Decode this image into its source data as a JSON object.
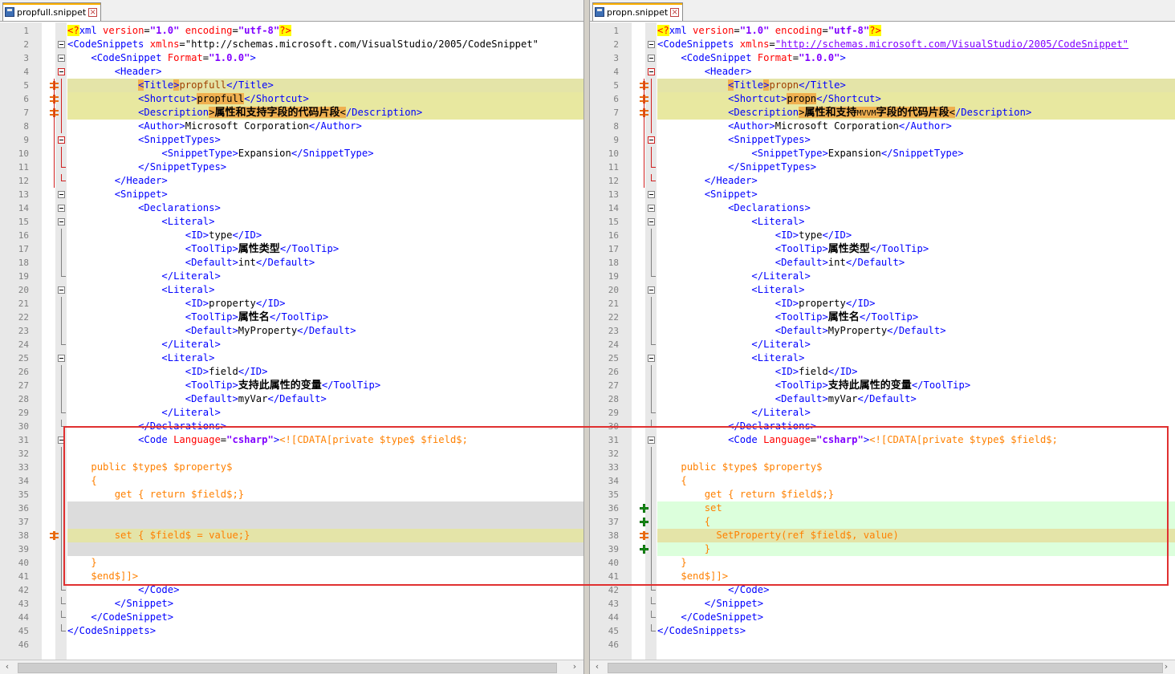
{
  "left": {
    "tab": "propfull.snippet",
    "lines": [
      {
        "n": "1",
        "html": "<span class='c-pi'>&lt;?</span><span class='c-tag'>xml </span><span class='c-attr'>version</span>=<span class='c-val'>\"1.0\"</span> <span class='c-attr'>encoding</span>=<span class='c-val'>\"utf-8\"</span><span class='c-pi'>?&gt;</span>"
      },
      {
        "n": "2",
        "html": "<span class='c-tag'>&lt;CodeSnippets </span><span class='c-attr'>xmlns</span>=\"http://schemas.microsoft.com/VisualStudio/2005/CodeSnippet\""
      },
      {
        "n": "3",
        "html": "    <span class='c-tag'>&lt;CodeSnippet </span><span class='c-attr'>Format</span>=<span class='c-val'>\"1.0.0\"</span><span class='c-tag'>&gt;</span>"
      },
      {
        "n": "4",
        "html": "        <span class='c-tag'>&lt;Header&gt;</span>"
      },
      {
        "n": "5",
        "html": "            <span class='c-tag' style='background:#f0b050'>&lt;</span><span class='c-tag'>Title</span><span class='c-tag' style='background:#f0b050'>&gt;</span><span style='color:#a04000'>propfull</span><span class='c-tag'>&lt;/Title&gt;</span>"
      },
      {
        "n": "6",
        "html": "            <span class='c-tag'>&lt;Shortcut&gt;</span><span class='c-hilite'>propfull</span><span class='c-tag'>&lt;/Shortcut&gt;</span>"
      },
      {
        "n": "7",
        "html": "            <span class='c-tag'>&lt;Description</span><span class='c-hilite'>&gt;<span class='c-cn'>属性和支持字段的代码片段</span>&lt;</span><span class='c-tag'>/Description&gt;</span>"
      },
      {
        "n": "8",
        "html": "            <span class='c-tag'>&lt;Author&gt;</span>Microsoft Corporation<span class='c-tag'>&lt;/Author&gt;</span>"
      },
      {
        "n": "9",
        "html": "            <span class='c-tag'>&lt;SnippetTypes&gt;</span>"
      },
      {
        "n": "10",
        "html": "                <span class='c-tag'>&lt;SnippetType&gt;</span>Expansion<span class='c-tag'>&lt;/SnippetType&gt;</span>"
      },
      {
        "n": "11",
        "html": "            <span class='c-tag'>&lt;/SnippetTypes&gt;</span>"
      },
      {
        "n": "12",
        "html": "        <span class='c-tag'>&lt;/Header&gt;</span>"
      },
      {
        "n": "13",
        "html": "        <span class='c-tag'>&lt;Snippet&gt;</span>"
      },
      {
        "n": "14",
        "html": "            <span class='c-tag'>&lt;Declarations&gt;</span>"
      },
      {
        "n": "15",
        "html": "                <span class='c-tag'>&lt;Literal&gt;</span>"
      },
      {
        "n": "16",
        "html": "                    <span class='c-tag'>&lt;ID&gt;</span>type<span class='c-tag'>&lt;/ID&gt;</span>"
      },
      {
        "n": "17",
        "html": "                    <span class='c-tag'>&lt;ToolTip&gt;</span><span class='c-cn'>属性类型</span><span class='c-tag'>&lt;/ToolTip&gt;</span>"
      },
      {
        "n": "18",
        "html": "                    <span class='c-tag'>&lt;Default&gt;</span>int<span class='c-tag'>&lt;/Default&gt;</span>"
      },
      {
        "n": "19",
        "html": "                <span class='c-tag'>&lt;/Literal&gt;</span>"
      },
      {
        "n": "20",
        "html": "                <span class='c-tag'>&lt;Literal&gt;</span>"
      },
      {
        "n": "21",
        "html": "                    <span class='c-tag'>&lt;ID&gt;</span>property<span class='c-tag'>&lt;/ID&gt;</span>"
      },
      {
        "n": "22",
        "html": "                    <span class='c-tag'>&lt;ToolTip&gt;</span><span class='c-cn'>属性名</span><span class='c-tag'>&lt;/ToolTip&gt;</span>"
      },
      {
        "n": "23",
        "html": "                    <span class='c-tag'>&lt;Default&gt;</span>MyProperty<span class='c-tag'>&lt;/Default&gt;</span>"
      },
      {
        "n": "24",
        "html": "                <span class='c-tag'>&lt;/Literal&gt;</span>"
      },
      {
        "n": "25",
        "html": "                <span class='c-tag'>&lt;Literal&gt;</span>"
      },
      {
        "n": "26",
        "html": "                    <span class='c-tag'>&lt;ID&gt;</span>field<span class='c-tag'>&lt;/ID&gt;</span>"
      },
      {
        "n": "27",
        "html": "                    <span class='c-tag'>&lt;ToolTip&gt;</span><span class='c-cn'>支持此属性的变量</span><span class='c-tag'>&lt;/ToolTip&gt;</span>"
      },
      {
        "n": "28",
        "html": "                    <span class='c-tag'>&lt;Default&gt;</span>myVar<span class='c-tag'>&lt;/Default&gt;</span>"
      },
      {
        "n": "29",
        "html": "                <span class='c-tag'>&lt;/Literal&gt;</span>"
      },
      {
        "n": "30",
        "html": "            <span class='c-tag'>&lt;/Declarations&gt;</span>"
      },
      {
        "n": "31",
        "html": "            <span class='c-tag'>&lt;Code </span><span class='c-attr'>Language</span>=<span class='c-val'>\"csharp\"</span><span class='c-tag'>&gt;</span><span class='c-cdata'>&lt;![CDATA[private $type$ $field$;</span>"
      },
      {
        "n": "32",
        "html": ""
      },
      {
        "n": "33",
        "html": "    <span class='c-cdata'>public $type$ $property$</span>"
      },
      {
        "n": "34",
        "html": "    <span class='c-cdata'>{</span>"
      },
      {
        "n": "35",
        "html": "        <span class='c-cdata'>get { return $field$;}</span>"
      },
      {
        "n": "36",
        "html": ""
      },
      {
        "n": "37",
        "html": ""
      },
      {
        "n": "38",
        "html": "        <span class='c-cdata'>set { $field$ = value;}</span>"
      },
      {
        "n": "39",
        "html": ""
      },
      {
        "n": "40",
        "html": "    <span class='c-cdata'>}</span>"
      },
      {
        "n": "41",
        "html": "    <span class='c-cdata'>$end$]]&gt;</span>"
      },
      {
        "n": "42",
        "html": "            <span class='c-tag'>&lt;/Code&gt;</span>"
      },
      {
        "n": "43",
        "html": "        <span class='c-tag'>&lt;/Snippet&gt;</span>"
      },
      {
        "n": "44",
        "html": "    <span class='c-tag'>&lt;/CodeSnippet&gt;</span>"
      },
      {
        "n": "45",
        "html": "<span class='c-tag'>&lt;/CodeSnippets&gt;</span>"
      },
      {
        "n": "46",
        "html": ""
      }
    ]
  },
  "right": {
    "tab": "propn.snippet",
    "lines": [
      {
        "n": "1",
        "html": "<span class='c-pi'>&lt;?</span><span class='c-tag'>xml </span><span class='c-attr'>version</span>=<span class='c-val'>\"1.0\"</span> <span class='c-attr'>encoding</span>=<span class='c-val'>\"utf-8\"</span><span class='c-pi'>?&gt;</span>"
      },
      {
        "n": "2",
        "html": "<span class='c-tag'>&lt;CodeSnippets </span><span class='c-attr'>xmlns</span>=<span class='c-u'>\"http://schemas.microsoft.com/VisualStudio/2005/CodeSnippet\"</span>"
      },
      {
        "n": "3",
        "html": "    <span class='c-tag'>&lt;CodeSnippet </span><span class='c-attr'>Format</span>=<span class='c-val'>\"1.0.0\"</span><span class='c-tag'>&gt;</span>"
      },
      {
        "n": "4",
        "html": "        <span class='c-tag'>&lt;Header&gt;</span>"
      },
      {
        "n": "5",
        "html": "            <span class='c-tag' style='background:#f0b050'>&lt;</span><span class='c-tag'>Title</span><span class='c-tag' style='background:#f0b050'>&gt;</span><span style='color:#a04000'>propn</span><span class='c-tag'>&lt;/Title&gt;</span>"
      },
      {
        "n": "6",
        "html": "            <span class='c-tag'>&lt;Shortcut&gt;</span><span class='c-hilite'>propn</span><span class='c-tag'>&lt;/Shortcut&gt;</span>"
      },
      {
        "n": "7",
        "html": "            <span class='c-tag'>&lt;Description</span><span class='c-hilite'>&gt;<span class='c-cn'>属性和支持</span><span style='font-size:10px'>MVVM</span><span class='c-cn'>字段的代码片段</span>&lt;</span><span class='c-tag'>/Description&gt;</span>"
      },
      {
        "n": "8",
        "html": "            <span class='c-tag'>&lt;Author&gt;</span>Microsoft Corporation<span class='c-tag'>&lt;/Author&gt;</span>"
      },
      {
        "n": "9",
        "html": "            <span class='c-tag'>&lt;SnippetTypes&gt;</span>"
      },
      {
        "n": "10",
        "html": "                <span class='c-tag'>&lt;SnippetType&gt;</span>Expansion<span class='c-tag'>&lt;/SnippetType&gt;</span>"
      },
      {
        "n": "11",
        "html": "            <span class='c-tag'>&lt;/SnippetTypes&gt;</span>"
      },
      {
        "n": "12",
        "html": "        <span class='c-tag'>&lt;/Header&gt;</span>"
      },
      {
        "n": "13",
        "html": "        <span class='c-tag'>&lt;Snippet&gt;</span>"
      },
      {
        "n": "14",
        "html": "            <span class='c-tag'>&lt;Declarations&gt;</span>"
      },
      {
        "n": "15",
        "html": "                <span class='c-tag'>&lt;Literal&gt;</span>"
      },
      {
        "n": "16",
        "html": "                    <span class='c-tag'>&lt;ID&gt;</span>type<span class='c-tag'>&lt;/ID&gt;</span>"
      },
      {
        "n": "17",
        "html": "                    <span class='c-tag'>&lt;ToolTip&gt;</span><span class='c-cn'>属性类型</span><span class='c-tag'>&lt;/ToolTip&gt;</span>"
      },
      {
        "n": "18",
        "html": "                    <span class='c-tag'>&lt;Default&gt;</span>int<span class='c-tag'>&lt;/Default&gt;</span>"
      },
      {
        "n": "19",
        "html": "                <span class='c-tag'>&lt;/Literal&gt;</span>"
      },
      {
        "n": "20",
        "html": "                <span class='c-tag'>&lt;Literal&gt;</span>"
      },
      {
        "n": "21",
        "html": "                    <span class='c-tag'>&lt;ID&gt;</span>property<span class='c-tag'>&lt;/ID&gt;</span>"
      },
      {
        "n": "22",
        "html": "                    <span class='c-tag'>&lt;ToolTip&gt;</span><span class='c-cn'>属性名</span><span class='c-tag'>&lt;/ToolTip&gt;</span>"
      },
      {
        "n": "23",
        "html": "                    <span class='c-tag'>&lt;Default&gt;</span>MyProperty<span class='c-tag'>&lt;/Default&gt;</span>"
      },
      {
        "n": "24",
        "html": "                <span class='c-tag'>&lt;/Literal&gt;</span>"
      },
      {
        "n": "25",
        "html": "                <span class='c-tag'>&lt;Literal&gt;</span>"
      },
      {
        "n": "26",
        "html": "                    <span class='c-tag'>&lt;ID&gt;</span>field<span class='c-tag'>&lt;/ID&gt;</span>"
      },
      {
        "n": "27",
        "html": "                    <span class='c-tag'>&lt;ToolTip&gt;</span><span class='c-cn'>支持此属性的变量</span><span class='c-tag'>&lt;/ToolTip&gt;</span>"
      },
      {
        "n": "28",
        "html": "                    <span class='c-tag'>&lt;Default&gt;</span>myVar<span class='c-tag'>&lt;/Default&gt;</span>"
      },
      {
        "n": "29",
        "html": "                <span class='c-tag'>&lt;/Literal&gt;</span>"
      },
      {
        "n": "30",
        "html": "            <span class='c-tag'>&lt;/Declarations&gt;</span>"
      },
      {
        "n": "31",
        "html": "            <span class='c-tag'>&lt;Code </span><span class='c-attr'>Language</span>=<span class='c-val'>\"csharp\"</span><span class='c-tag'>&gt;</span><span class='c-cdata'>&lt;![CDATA[private $type$ $field$;</span>"
      },
      {
        "n": "32",
        "html": ""
      },
      {
        "n": "33",
        "html": "    <span class='c-cdata'>public $type$ $property$</span>"
      },
      {
        "n": "34",
        "html": "    <span class='c-cdata'>{</span>"
      },
      {
        "n": "35",
        "html": "        <span class='c-cdata'>get { return $field$;}</span>"
      },
      {
        "n": "36",
        "html": "        <span class='c-cdata'>set</span>"
      },
      {
        "n": "37",
        "html": "        <span class='c-cdata'>{</span>"
      },
      {
        "n": "38",
        "html": "          <span class='c-cdata'>SetProperty(ref $field$, value)</span>"
      },
      {
        "n": "39",
        "html": "        <span class='c-cdata'>}</span>"
      },
      {
        "n": "40",
        "html": "    <span class='c-cdata'>}</span>"
      },
      {
        "n": "41",
        "html": "    <span class='c-cdata'>$end$]]&gt;</span>"
      },
      {
        "n": "42",
        "html": "            <span class='c-tag'>&lt;/Code&gt;</span>"
      },
      {
        "n": "43",
        "html": "        <span class='c-tag'>&lt;/Snippet&gt;</span>"
      },
      {
        "n": "44",
        "html": "    <span class='c-tag'>&lt;/CodeSnippet&gt;</span>"
      },
      {
        "n": "45",
        "html": "<span class='c-tag'>&lt;/CodeSnippets&gt;</span>"
      },
      {
        "n": "46",
        "html": ""
      }
    ]
  },
  "icons": {
    "tab_file": "file-icon",
    "tab_close": "close-icon",
    "fold": "fold-minus-icon",
    "diff_changed": "diff-changed-icon",
    "diff_added": "diff-added-icon",
    "scroll_left": "arrow-left-icon",
    "scroll_right": "arrow-right-icon"
  },
  "glyphs": {
    "close": "×",
    "scroll_left": "‹",
    "scroll_right": "›"
  },
  "colors": {
    "tag": "#0000ff",
    "attribute": "#ff0000",
    "value": "#8000ff",
    "cdata": "#ff8000",
    "changed": "#e4e4a8",
    "added": "#dcffdc",
    "deleted": "#dcdcdc",
    "annotation_box": "#e03030"
  }
}
